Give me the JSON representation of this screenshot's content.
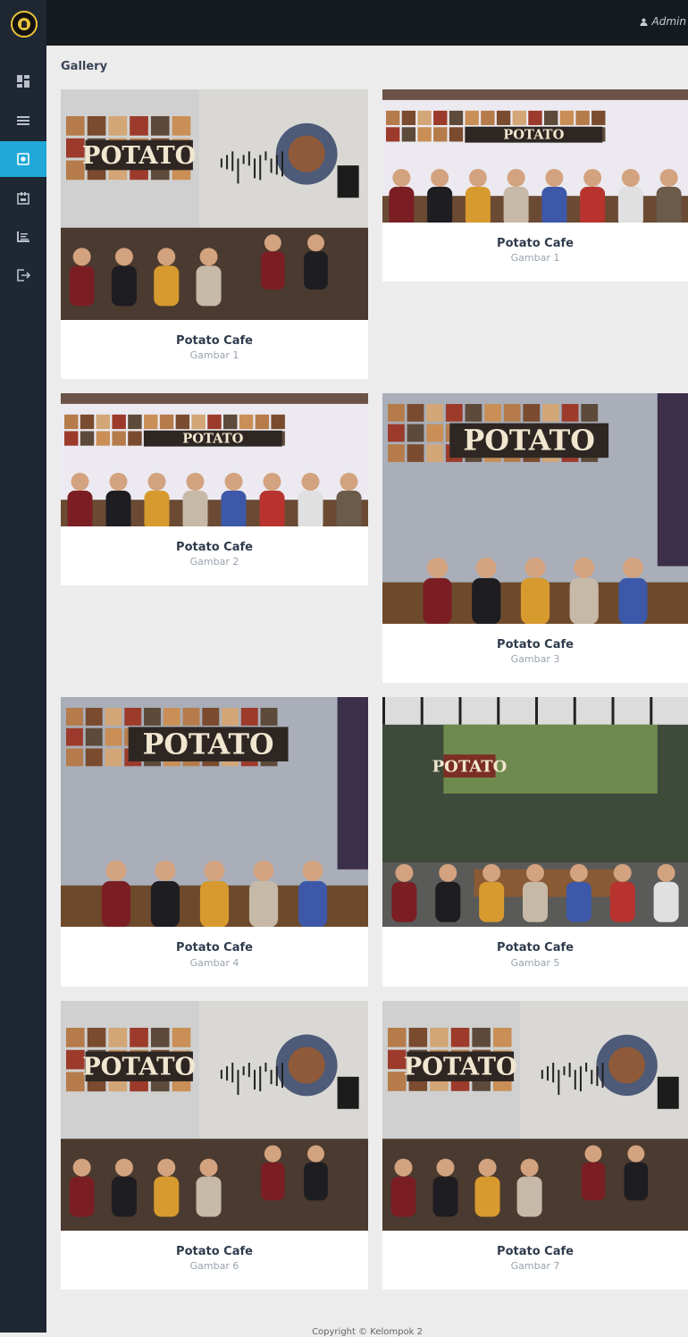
{
  "topbar": {
    "user_label": "Admin"
  },
  "sidebar": {
    "items": [
      {
        "icon": "dashboard-icon"
      },
      {
        "icon": "menu-icon"
      },
      {
        "icon": "gallery-icon",
        "active": true
      },
      {
        "icon": "calendar-icon"
      },
      {
        "icon": "report-icon"
      },
      {
        "icon": "logout-icon"
      }
    ]
  },
  "main": {
    "title": "Gallery",
    "cards": [
      {
        "title": "Potato Cafe",
        "subtitle": "Gambar 1"
      },
      {
        "title": "Potato Cafe",
        "subtitle": "Gambar 1"
      },
      {
        "title": "Potato Cafe",
        "subtitle": "Gambar 2"
      },
      {
        "title": "Potato Cafe",
        "subtitle": "Gambar 3"
      },
      {
        "title": "Potato Cafe",
        "subtitle": "Gambar 4"
      },
      {
        "title": "Potato Cafe",
        "subtitle": "Gambar 5"
      },
      {
        "title": "Potato Cafe",
        "subtitle": "Gambar 6"
      },
      {
        "title": "Potato Cafe",
        "subtitle": "Gambar 7"
      }
    ],
    "photo_sign_text": "POTATO"
  },
  "footer": {
    "text": "Copyright © Kelompok 2"
  },
  "colors": {
    "accent": "#20a8d8",
    "sidebar": "#1f2733",
    "topbar": "#151a21"
  }
}
